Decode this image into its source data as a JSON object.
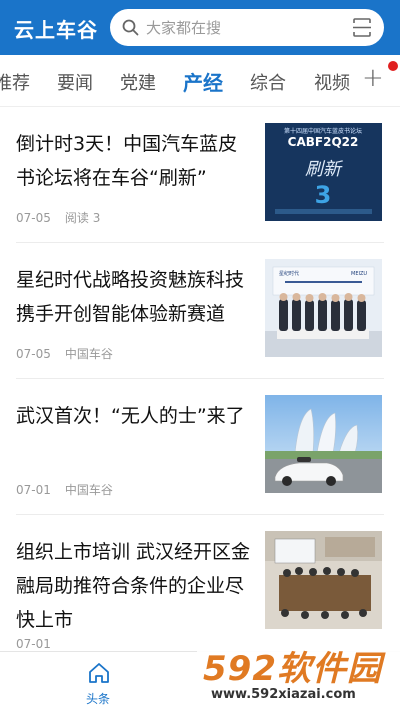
{
  "header": {
    "app_title": "云上车谷",
    "search_placeholder": "大家都在搜"
  },
  "tabs": [
    {
      "label": "推荐",
      "active": false
    },
    {
      "label": "要闻",
      "active": false
    },
    {
      "label": "党建",
      "active": false
    },
    {
      "label": "产经",
      "active": true
    },
    {
      "label": "综合",
      "active": false
    },
    {
      "label": "视频",
      "active": false
    }
  ],
  "tabs_more": "+",
  "news": [
    {
      "title": "倒计时3天！中国汽车蓝皮书论坛将在车谷“刷新”",
      "date": "07-05",
      "source": "阅读 3",
      "thumb": {
        "top_text": "第十四届中国汽车蓝皮书论坛",
        "main_text": "CABF2Q22",
        "accent_text": "刷新",
        "number": "3"
      }
    },
    {
      "title": "星纪时代战略投资魅族科技 携手开创智能体验新赛道",
      "date": "07-05",
      "source": "中国车谷",
      "thumb": {
        "brand_left": "星纪时代",
        "brand_right": "MEIZU"
      }
    },
    {
      "title": "武汉首次！“无人的士”来了",
      "date": "07-01",
      "source": "中国车谷",
      "thumb": {}
    },
    {
      "title": "组织上市培训 武汉经开区金融局助推符合条件的企业尽快上市",
      "date": "07-01",
      "source": "",
      "thumb": {}
    }
  ],
  "bottom_nav": {
    "home_label": "头条"
  },
  "watermark": {
    "big": "592软件园",
    "small": "www.592xiazai.com"
  },
  "colors": {
    "brand": "#1a74c9",
    "badge": "#e02020",
    "watermark": "#e07a23"
  }
}
